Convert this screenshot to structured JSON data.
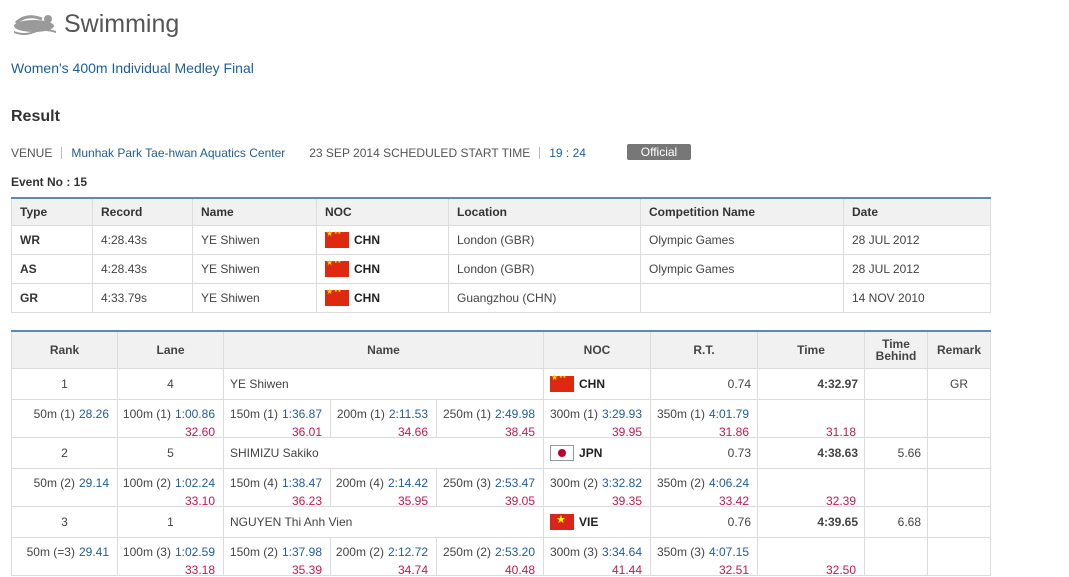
{
  "header": {
    "sport": "Swimming",
    "sport_icon": "swimmer-icon"
  },
  "event_title": "Women's 400m Individual Medley Final",
  "result_heading": "Result",
  "venue": {
    "label": "VENUE",
    "name": "Munhak Park Tae-hwan Aquatics Center",
    "date_text": "23 SEP 2014 SCHEDULED START TIME",
    "time": "19 : 24",
    "status": "Official"
  },
  "event_no": "Event No : 15",
  "records": {
    "headers": [
      "Type",
      "Record",
      "Name",
      "NOC",
      "Location",
      "Competition Name",
      "Date"
    ],
    "rows": [
      {
        "type": "WR",
        "record": "4:28.43s",
        "name": "YE Shiwen",
        "noc": "CHN",
        "location": "London (GBR)",
        "competition": "Olympic Games",
        "date": "28 JUL 2012"
      },
      {
        "type": "AS",
        "record": "4:28.43s",
        "name": "YE Shiwen",
        "noc": "CHN",
        "location": "London (GBR)",
        "competition": "Olympic Games",
        "date": "28 JUL 2012"
      },
      {
        "type": "GR",
        "record": "4:33.79s",
        "name": "YE Shiwen",
        "noc": "CHN",
        "location": "Guangzhou (CHN)",
        "competition": "",
        "date": "14 NOV 2010"
      }
    ]
  },
  "results": {
    "headers": {
      "rank": "Rank",
      "lane": "Lane",
      "name": "Name",
      "noc": "NOC",
      "rt": "R.T.",
      "time": "Time",
      "time_behind": "Time Behind",
      "remark": "Remark"
    },
    "rows": [
      {
        "rank": "1",
        "lane": "4",
        "name": "YE Shiwen",
        "noc": "CHN",
        "rt": "0.74",
        "time": "4:32.97",
        "behind": "",
        "remark": "GR",
        "splits": [
          {
            "label": "50m (1)",
            "value": "28.26",
            "lap": ""
          },
          {
            "label": "100m (1)",
            "value": "1:00.86",
            "lap": "32.60"
          },
          {
            "label": "150m (1)",
            "value": "1:36.87",
            "lap": "36.01"
          },
          {
            "label": "200m (1)",
            "value": "2:11.53",
            "lap": "34.66"
          },
          {
            "label": "250m (1)",
            "value": "2:49.98",
            "lap": "38.45"
          },
          {
            "label": "300m (1)",
            "value": "3:29.93",
            "lap": "39.95"
          },
          {
            "label": "350m (1)",
            "value": "4:01.79",
            "lap": "31.86"
          },
          {
            "label": "",
            "value": "",
            "lap": "31.18"
          }
        ]
      },
      {
        "rank": "2",
        "lane": "5",
        "name": "SHIMIZU Sakiko",
        "noc": "JPN",
        "rt": "0.73",
        "time": "4:38.63",
        "behind": "5.66",
        "remark": "",
        "splits": [
          {
            "label": "50m (2)",
            "value": "29.14",
            "lap": ""
          },
          {
            "label": "100m (2)",
            "value": "1:02.24",
            "lap": "33.10"
          },
          {
            "label": "150m (4)",
            "value": "1:38.47",
            "lap": "36.23"
          },
          {
            "label": "200m (4)",
            "value": "2:14.42",
            "lap": "35.95"
          },
          {
            "label": "250m (3)",
            "value": "2:53.47",
            "lap": "39.05"
          },
          {
            "label": "300m (2)",
            "value": "3:32.82",
            "lap": "39.35"
          },
          {
            "label": "350m (2)",
            "value": "4:06.24",
            "lap": "33.42"
          },
          {
            "label": "",
            "value": "",
            "lap": "32.39"
          }
        ]
      },
      {
        "rank": "3",
        "lane": "1",
        "name": "NGUYEN Thi Anh Vien",
        "noc": "VIE",
        "rt": "0.76",
        "time": "4:39.65",
        "behind": "6.68",
        "remark": "",
        "splits": [
          {
            "label": "50m (=3)",
            "value": "29.41",
            "lap": ""
          },
          {
            "label": "100m (3)",
            "value": "1:02.59",
            "lap": "33.18"
          },
          {
            "label": "150m (2)",
            "value": "1:37.98",
            "lap": "35.39"
          },
          {
            "label": "200m (2)",
            "value": "2:12.72",
            "lap": "34.74"
          },
          {
            "label": "250m (2)",
            "value": "2:53.20",
            "lap": "40.48"
          },
          {
            "label": "300m (3)",
            "value": "3:34.64",
            "lap": "41.44"
          },
          {
            "label": "350m (3)",
            "value": "4:07.15",
            "lap": "32.51"
          },
          {
            "label": "",
            "value": "",
            "lap": "32.50"
          }
        ]
      }
    ]
  },
  "colors": {
    "link": "#1f5d9b",
    "lap": "#c8164c",
    "header_border": "#5a8ab9",
    "badge": "#777777"
  }
}
